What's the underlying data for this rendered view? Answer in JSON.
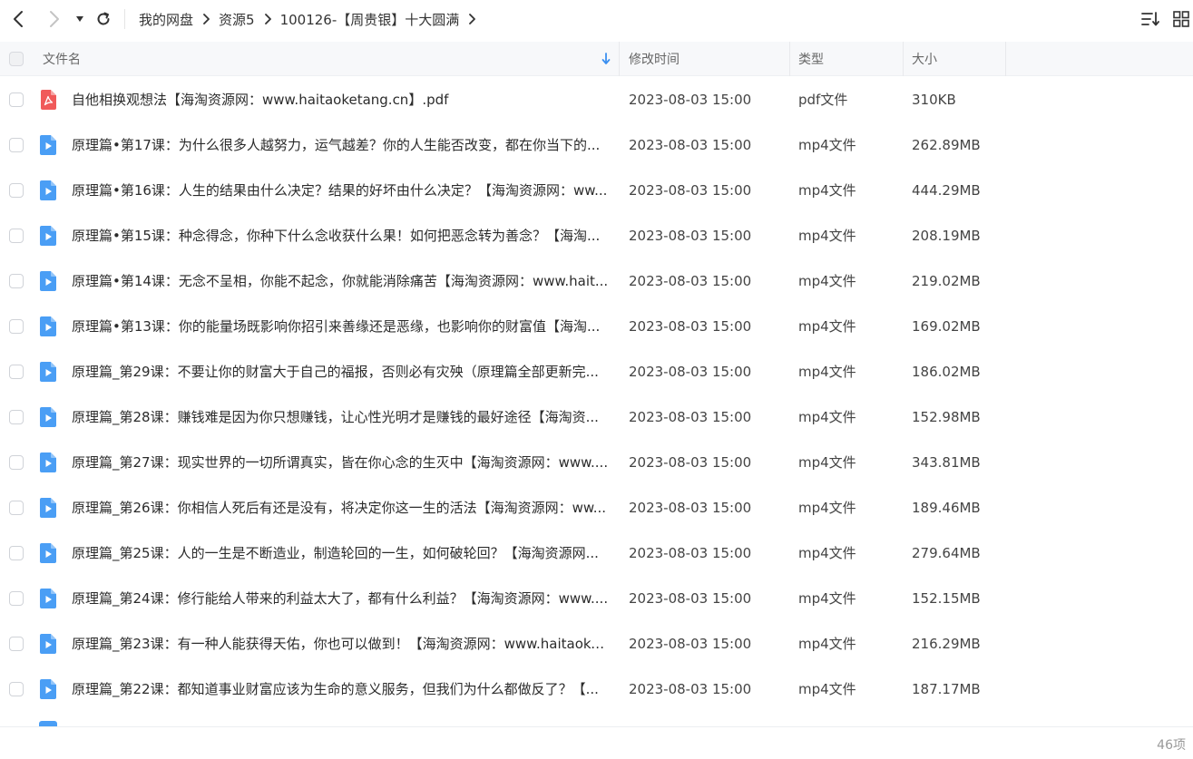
{
  "nav": {
    "back_icon": "chevron-left-icon",
    "forward_icon": "chevron-right-icon",
    "dropdown_icon": "triangle-down-icon",
    "refresh_icon": "refresh-icon"
  },
  "breadcrumb": [
    "我的网盘",
    "资源5",
    "100126-【周贵银】十大圆满"
  ],
  "toolbar": {
    "sort_icon": "sort-icon",
    "grid_icon": "grid-view-icon"
  },
  "columns": {
    "name": "文件名",
    "modified": "修改时间",
    "type": "类型",
    "size": "大小"
  },
  "files": [
    {
      "name": "自他相换观想法【海淘资源网：www.haitaoketang.cn】.pdf",
      "time": "2023-08-03 15:00",
      "type": "pdf文件",
      "size": "310KB",
      "kind": "pdf"
    },
    {
      "name": "原理篇•第17课：为什么很多人越努力，运气越差？你的人生能否改变，都在你当下的...",
      "time": "2023-08-03 15:00",
      "type": "mp4文件",
      "size": "262.89MB",
      "kind": "video"
    },
    {
      "name": "原理篇•第16课：人生的结果由什么决定？结果的好坏由什么决定？【海淘资源网：ww...",
      "time": "2023-08-03 15:00",
      "type": "mp4文件",
      "size": "444.29MB",
      "kind": "video"
    },
    {
      "name": "原理篇•第15课：种念得念，你种下什么念收获什么果！如何把恶念转为善念？【海淘...",
      "time": "2023-08-03 15:00",
      "type": "mp4文件",
      "size": "208.19MB",
      "kind": "video"
    },
    {
      "name": "原理篇•第14课：无念不呈相，你能不起念，你就能消除痛苦【海淘资源网：www.hait...",
      "time": "2023-08-03 15:00",
      "type": "mp4文件",
      "size": "219.02MB",
      "kind": "video"
    },
    {
      "name": "原理篇•第13课：你的能量场既影响你招引来善缘还是恶缘，也影响你的财富值【海淘...",
      "time": "2023-08-03 15:00",
      "type": "mp4文件",
      "size": "169.02MB",
      "kind": "video"
    },
    {
      "name": "原理篇_第29课：不要让你的财富大于自己的福报，否则必有灾殃（原理篇全部更新完...",
      "time": "2023-08-03 15:00",
      "type": "mp4文件",
      "size": "186.02MB",
      "kind": "video"
    },
    {
      "name": "原理篇_第28课：赚钱难是因为你只想赚钱，让心性光明才是赚钱的最好途径【海淘资...",
      "time": "2023-08-03 15:00",
      "type": "mp4文件",
      "size": "152.98MB",
      "kind": "video"
    },
    {
      "name": "原理篇_第27课：现实世界的一切所谓真实，皆在你心念的生灭中【海淘资源网：www....",
      "time": "2023-08-03 15:00",
      "type": "mp4文件",
      "size": "343.81MB",
      "kind": "video"
    },
    {
      "name": "原理篇_第26课：你相信人死后有还是没有，将决定你这一生的活法【海淘资源网：ww...",
      "time": "2023-08-03 15:00",
      "type": "mp4文件",
      "size": "189.46MB",
      "kind": "video"
    },
    {
      "name": "原理篇_第25课：人的一生是不断造业，制造轮回的一生，如何破轮回？【海淘资源网...",
      "time": "2023-08-03 15:00",
      "type": "mp4文件",
      "size": "279.64MB",
      "kind": "video"
    },
    {
      "name": "原理篇_第24课：修行能给人带来的利益太大了，都有什么利益？【海淘资源网：www....",
      "time": "2023-08-03 15:00",
      "type": "mp4文件",
      "size": "152.15MB",
      "kind": "video"
    },
    {
      "name": "原理篇_第23课：有一种人能获得天佑，你也可以做到！【海淘资源网：www.haitaoke...",
      "time": "2023-08-03 15:00",
      "type": "mp4文件",
      "size": "216.29MB",
      "kind": "video"
    },
    {
      "name": "原理篇_第22课：都知道事业财富应该为生命的意义服务，但我们为什么都做反了？【...",
      "time": "2023-08-03 15:00",
      "type": "mp4文件",
      "size": "187.17MB",
      "kind": "video"
    }
  ],
  "status": {
    "count": "46项"
  },
  "colors": {
    "pdf_icon": "#f05a5a",
    "video_icon": "#4a9ef5",
    "sort_arrow": "#3b8ff0",
    "header_bg": "#f7f8fa"
  }
}
